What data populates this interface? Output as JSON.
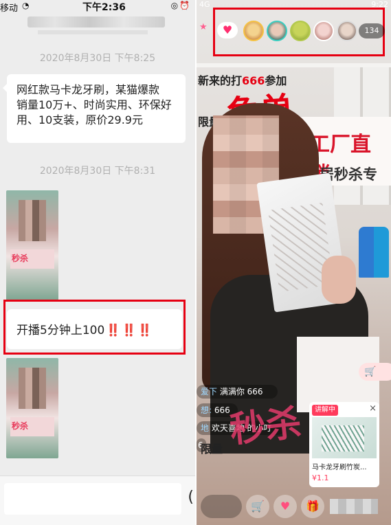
{
  "left": {
    "status": {
      "carrier": "移动",
      "time": "下午2:36"
    },
    "timestamps": [
      "2020年8月30日 下午8:25",
      "2020年8月30日 下午8:31"
    ],
    "message1_lines": [
      "网红款马卡龙牙刷，某猫爆款",
      "销量10万+、时尚实用、环保好",
      "用、10支装，原价29.9元"
    ],
    "thumb_label": "秒杀",
    "message2": {
      "text": "开播5分钟上100",
      "marks": "‼️ ‼️ ‼️"
    },
    "input_glyph": "("
  },
  "right": {
    "status": {
      "left": "4G",
      "time": "9:22"
    },
    "viewer_count": "134",
    "sign_new": {
      "pre": "新来的打",
      "num": "666",
      "post": "参加"
    },
    "sign_free": "免单",
    "sign_limit": "限量",
    "sign_factory": "工厂直销",
    "sign_home": "家居秒杀专场",
    "chats": [
      {
        "user": "爱下",
        "text": "满满你  666"
      },
      {
        "user": "想:",
        "text": "666"
      },
      {
        "user": "地",
        "text": "欢天喜地 的小叮"
      },
      {
        "user": "",
        "text": "6"
      }
    ],
    "limit2": "限量",
    "big_sale": "秒杀",
    "card": {
      "badge": "讲解中",
      "title": "马卡龙牙刷竹炭...",
      "price": "¥1.1",
      "close": "×"
    },
    "icons": {
      "star": "★",
      "heart": "♥",
      "cart": "🛒",
      "gift": "🎁"
    },
    "accent": "#e60012"
  }
}
